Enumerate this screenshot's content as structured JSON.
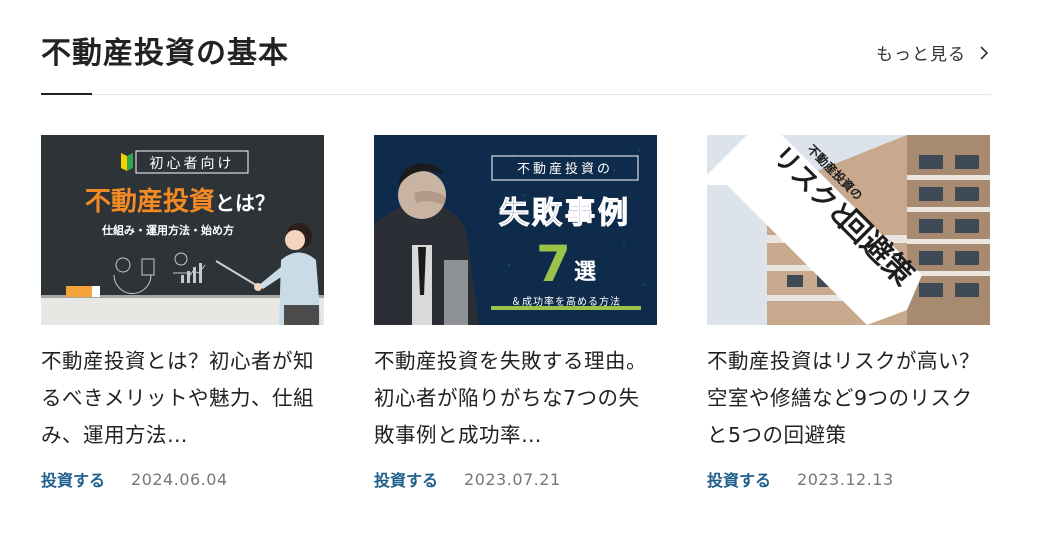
{
  "section": {
    "title": "不動産投資の基本",
    "more_label": "もっと見る"
  },
  "cards": [
    {
      "title": "不動産投資とは？初心者が知るべきメリットや魅力、仕組み、運用方法…",
      "category": "投資する",
      "date": "2024.06.04",
      "thumb": {
        "badge": "初心者向け",
        "headline_accent": "不動産投資",
        "headline_rest": "とは？",
        "subline": "仕組み・運用方法・始め方"
      }
    },
    {
      "title": "不動産投資を失敗する理由。 初心者が陥りがちな7つの失敗事例と成功率…",
      "category": "投資する",
      "date": "2023.07.21",
      "thumb": {
        "box": "不動産投資の",
        "headline": "失敗事例",
        "number": "7",
        "number_suffix": "選",
        "subline": "＆成功率を高める方法"
      }
    },
    {
      "title": "不動産投資はリスクが高い？ 空室や修繕など9つのリスクと5つの回避策",
      "category": "投資する",
      "date": "2023.12.13",
      "thumb": {
        "line1": "不動産投資の",
        "line2": "リスクと",
        "line3": "回避策"
      }
    }
  ],
  "colors": {
    "accent_blue": "#1f5f8b",
    "card1_orange": "#f28b23",
    "card2_navy": "#0f2b4c",
    "card2_green": "#9bc34a"
  }
}
